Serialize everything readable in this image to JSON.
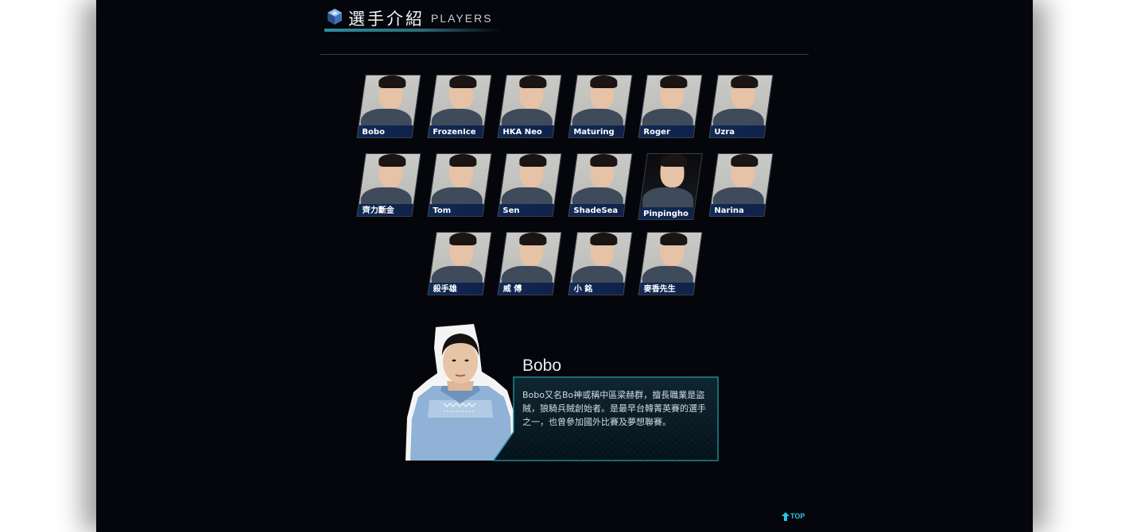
{
  "header": {
    "title_zh": "選手介紹",
    "title_en": "PLAYERS",
    "logo_icon": "crystal-gem-icon"
  },
  "players": [
    {
      "name": "Bobo"
    },
    {
      "name": "FrozenIce"
    },
    {
      "name": "HKA Neo"
    },
    {
      "name": "Maturing"
    },
    {
      "name": "Roger"
    },
    {
      "name": "Uzra"
    },
    {
      "name": "齊力斷金"
    },
    {
      "name": "Tom"
    },
    {
      "name": "Sen"
    },
    {
      "name": "ShadeSea"
    },
    {
      "name": "Pinpingho"
    },
    {
      "name": "Narina"
    },
    {
      "name": "殺手雄"
    },
    {
      "name": "威 傅"
    },
    {
      "name": "小 銘"
    },
    {
      "name": "麥香先生"
    }
  ],
  "featured": {
    "name": "Bobo",
    "description": "Bobo又名Bo神或稱中區梁赫群，擅長職業是盜賊，狼騎兵賊創始者。是最早台韓菁英賽的選手之一，也曾參加國外比賽及夢想聯賽。"
  },
  "footer": {
    "top_label": "TOP",
    "top_icon": "up-arrow-icon"
  },
  "colors": {
    "background": "#05060b",
    "accent": "#2ec4e6",
    "name_bar": "#102a56",
    "teal_line": "#2d8ea0"
  }
}
